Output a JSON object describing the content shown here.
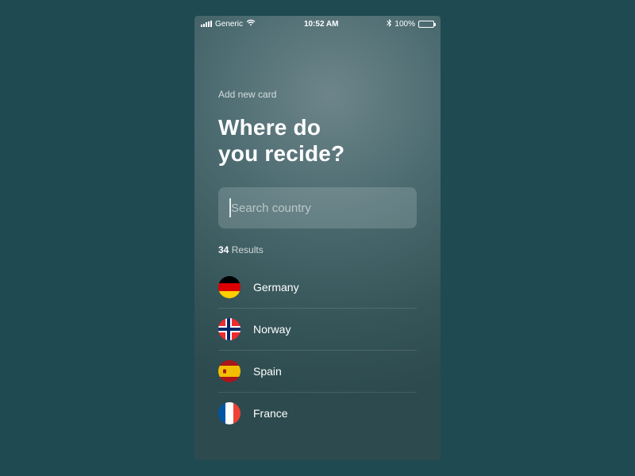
{
  "status_bar": {
    "carrier": "Generic",
    "time": "10:52 AM",
    "battery_pct": "100%",
    "bluetooth_icon": "bluetooth-icon",
    "wifi_icon": "wifi-icon"
  },
  "header": {
    "breadcrumb": "Add new card",
    "title_line1": "Where do",
    "title_line2": "you recide?"
  },
  "search": {
    "placeholder": "Search country",
    "value": ""
  },
  "results": {
    "count": "34",
    "label": "Results",
    "items": [
      {
        "name": "Germany",
        "flag_id": "de"
      },
      {
        "name": "Norway",
        "flag_id": "no"
      },
      {
        "name": "Spain",
        "flag_id": "es"
      },
      {
        "name": "France",
        "flag_id": "fr"
      }
    ]
  }
}
